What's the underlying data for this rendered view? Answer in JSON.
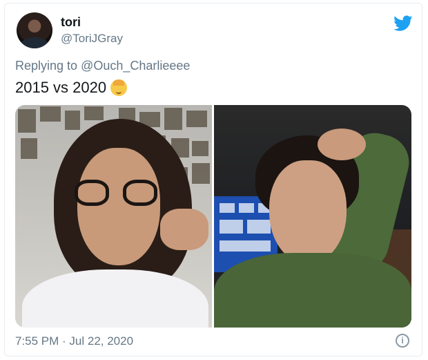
{
  "tweet": {
    "author_name": "tori",
    "author_handle": "@ToriJGray",
    "reply_prefix": "Replying to",
    "reply_to": "@Ouch_Charlieeee",
    "text": "2015 vs 2020",
    "emoji_icon": "baby-face-emoji",
    "timestamp": "7:55 PM · Jul 22, 2020"
  },
  "media": {
    "left_photo": "selfie-2015-photo",
    "right_photo": "selfie-2020-photo"
  },
  "colors": {
    "brand": "#1da1f2",
    "secondary_text": "#657786",
    "primary_text": "#0f1419"
  }
}
